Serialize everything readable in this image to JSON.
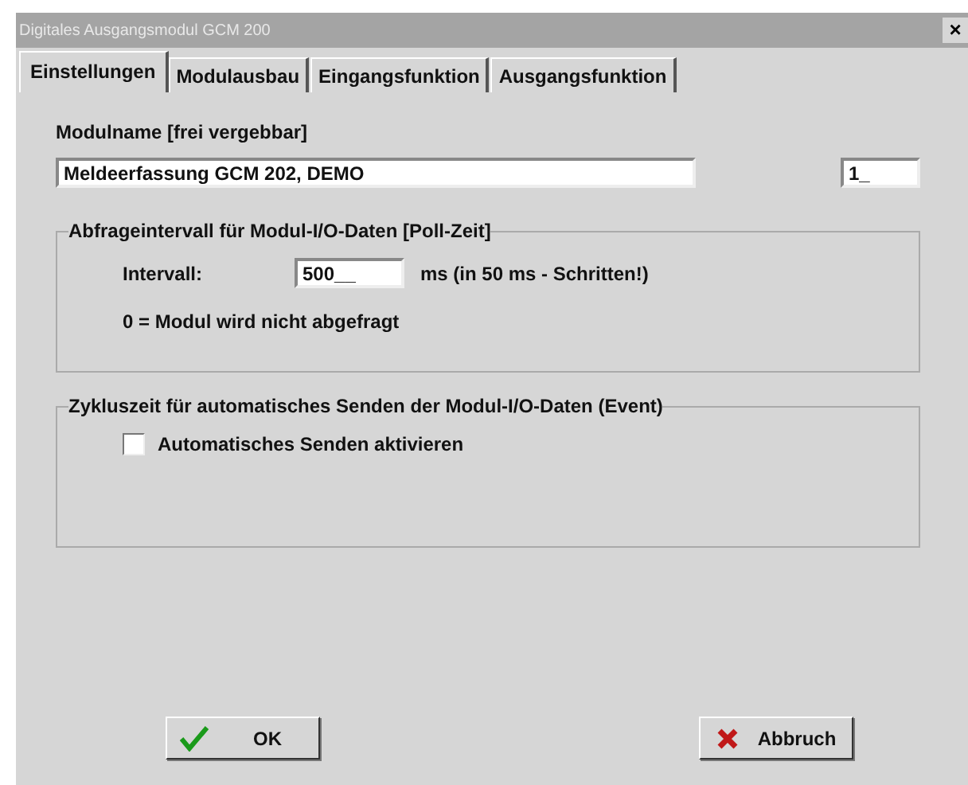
{
  "window": {
    "title": "Digitales Ausgangsmodul GCM 200",
    "close": "×"
  },
  "tabs": [
    {
      "label": "Einstellungen",
      "selected": true
    },
    {
      "label": "Modulausbau",
      "selected": false
    },
    {
      "label": "Eingangsfunktion",
      "selected": false
    },
    {
      "label": "Ausgangsfunktion",
      "selected": false
    }
  ],
  "module_name": {
    "label": "Modulname [frei vergebbar]",
    "value": "Meldeerfassung GCM 202, DEMO",
    "number": "1_"
  },
  "poll_group": {
    "legend": "Abfrageintervall für Modul-I/O-Daten [Poll-Zeit]",
    "interval_label": "Intervall:",
    "interval_value": "500__",
    "unit_note": "ms  (in 50 ms - Schritten!)",
    "hint": "0 = Modul wird nicht abgefragt"
  },
  "event_group": {
    "legend": "Zykluszeit für automatisches Senden der Modul-I/O-Daten (Event)",
    "checkbox": {
      "label": "Automatisches Senden aktivieren",
      "checked": false
    }
  },
  "buttons": [
    {
      "kind": "ok",
      "label": "OK"
    },
    {
      "kind": "cancel",
      "label": "Abbruch"
    }
  ]
}
